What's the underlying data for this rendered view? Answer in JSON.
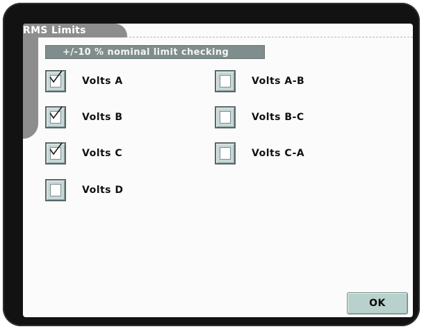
{
  "panel": {
    "title": "RMS Limits",
    "subtitle": "+/-10 % nominal limit checking"
  },
  "checkboxes": [
    {
      "label": "Volts A",
      "checked": true
    },
    {
      "label": "Volts B",
      "checked": true
    },
    {
      "label": "Volts C",
      "checked": true
    },
    {
      "label": "Volts D",
      "checked": false
    },
    {
      "label": "Volts A-B",
      "checked": false
    },
    {
      "label": "Volts B-C",
      "checked": false
    },
    {
      "label": "Volts C-A",
      "checked": false
    }
  ],
  "buttons": {
    "ok_label": "OK"
  },
  "icons": {
    "check": "checkmark-icon"
  }
}
